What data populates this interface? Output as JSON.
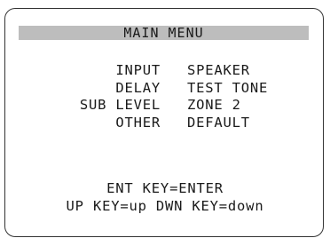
{
  "menu": {
    "title": "MAIN MENU",
    "left_items": [
      "INPUT",
      "DELAY",
      "SUB LEVEL",
      "OTHER"
    ],
    "right_items": [
      "SPEAKER",
      "TEST TONE",
      "ZONE 2",
      "DEFAULT"
    ]
  },
  "footer": {
    "line1": "ENT KEY=ENTER",
    "line2": "UP KEY=up   DWN KEY=down"
  },
  "colors": {
    "title_bar": "#bdbdbd",
    "text": "#1a1a1a",
    "border": "#333333",
    "background": "#ffffff"
  }
}
